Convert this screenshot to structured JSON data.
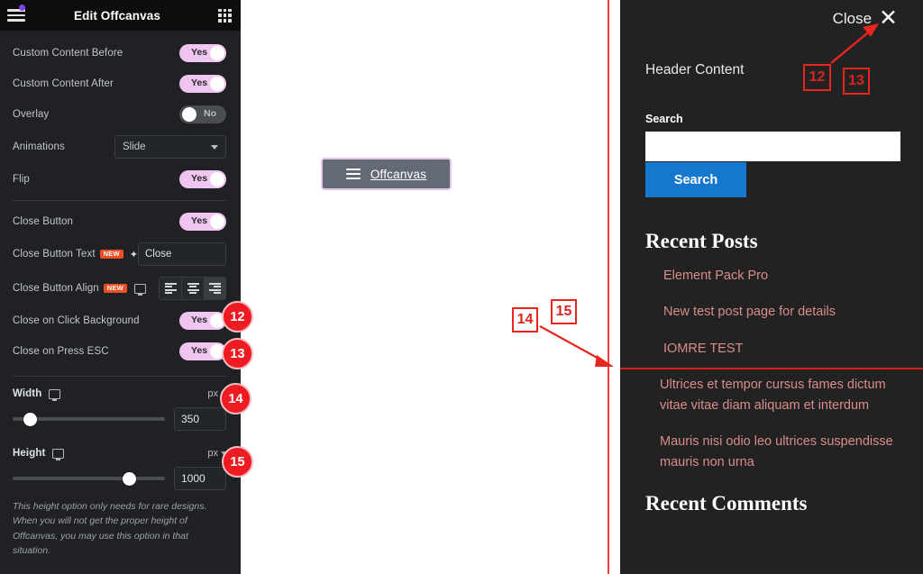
{
  "panel": {
    "title": "Edit Offcanvas",
    "menu_icon": "hamburger-icon",
    "apps_icon": "grid-apps-icon",
    "rows": [
      {
        "label": "Custom Content Before",
        "toggle": "Yes",
        "state": "on"
      },
      {
        "label": "Custom Content After",
        "toggle": "Yes",
        "state": "on"
      },
      {
        "label": "Overlay",
        "toggle": "No",
        "state": "off"
      }
    ],
    "animations": {
      "label": "Animations",
      "value": "Slide"
    },
    "flip": {
      "label": "Flip",
      "toggle": "Yes",
      "state": "on"
    },
    "close_button": {
      "label": "Close Button",
      "toggle": "Yes",
      "state": "on"
    },
    "close_button_text": {
      "label": "Close Button Text",
      "badge": "NEW",
      "value": "Close",
      "dynamic_icon": "database-icon",
      "ai_icon": "sparkle-icon"
    },
    "close_button_align": {
      "label": "Close Button Align",
      "badge": "NEW",
      "device_icon": "desktop-monitor-icon",
      "options": [
        "left",
        "center",
        "right"
      ],
      "selected": "right"
    },
    "close_on_click_background": {
      "label": "Close on Click Background",
      "toggle": "Yes",
      "state": "on"
    },
    "close_on_press_esc": {
      "label": "Close on Press ESC",
      "toggle": "Yes",
      "state": "on"
    },
    "width": {
      "label": "Width",
      "unit": "px",
      "value": "350",
      "slider_pct": 7,
      "device_icon": "desktop-monitor-icon"
    },
    "height": {
      "label": "Height",
      "unit": "px",
      "value": "1000",
      "slider_pct": 76,
      "device_icon": "desktop-monitor-icon"
    },
    "help_text": "This height option only needs for rare designs. When you will not get the proper height of Offcanvas, you may use this option in that situation."
  },
  "canvas": {
    "trigger": {
      "label": "Offcanvas",
      "icon": "hamburger-menu-icon"
    }
  },
  "offcanvas": {
    "close": {
      "label": "Close",
      "icon": "close-x-icon"
    },
    "header_content": "Header Content",
    "search": {
      "label": "Search",
      "value": "",
      "placeholder": "",
      "button": "Search"
    },
    "recent_posts": {
      "heading": "Recent Posts",
      "items": [
        "Element Pack Pro",
        "New test post page for details",
        "IOMRE TEST",
        "Ultrices et tempor cursus fames dictum vitae vitae diam aliquam et interdum",
        "Mauris nisi odio leo ultrices suspendisse mauris non urna"
      ]
    },
    "recent_comments": {
      "heading": "Recent Comments"
    }
  },
  "annotations": {
    "badges": [
      {
        "id": "12",
        "type": "circle"
      },
      {
        "id": "13",
        "type": "circle"
      },
      {
        "id": "14",
        "type": "circle"
      },
      {
        "id": "15",
        "type": "circle"
      }
    ],
    "boxes": [
      {
        "id": "12",
        "type": "box"
      },
      {
        "id": "13",
        "type": "box"
      },
      {
        "id": "14",
        "type": "box"
      },
      {
        "id": "15",
        "type": "box"
      }
    ],
    "accent_color": "#ee1c22"
  }
}
